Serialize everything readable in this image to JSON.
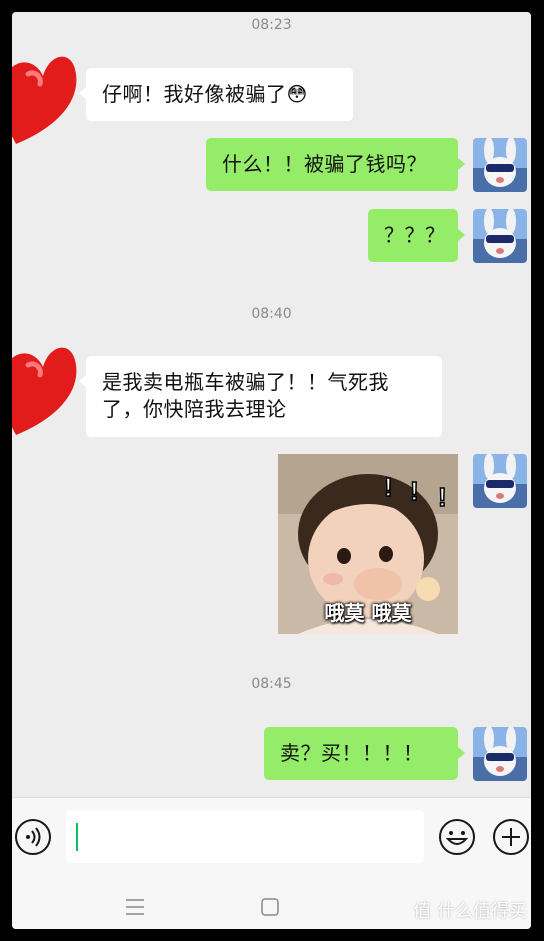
{
  "timestamps": [
    "08:23",
    "08:40",
    "08:45"
  ],
  "messages": [
    {
      "from": "contact",
      "text": "仔啊！我好像被骗了😳"
    },
    {
      "from": "me",
      "text": "什么！！被骗了钱吗？"
    },
    {
      "from": "me",
      "text": "？？？"
    },
    {
      "from": "contact",
      "line1": "是我卖电瓶车被骗了！！气死我",
      "line2": "了，你快陪我去理论"
    },
    {
      "from": "me",
      "type": "sticker",
      "caption": "哦莫 哦莫"
    },
    {
      "from": "me",
      "text": "卖？买！！！！"
    }
  ],
  "input": {
    "value": ""
  },
  "icons": {
    "voice": "voice-icon",
    "emoji": "emoji-icon",
    "plus": "plus-icon",
    "contact_avatar": "heart-icon",
    "menu": "menu-icon",
    "home": "home-icon"
  },
  "colors": {
    "out_bubble": "#95ec69",
    "in_bubble": "#ffffff",
    "background": "#ededed",
    "heart": "#e21b1b"
  },
  "watermark": "值 什么值得买"
}
